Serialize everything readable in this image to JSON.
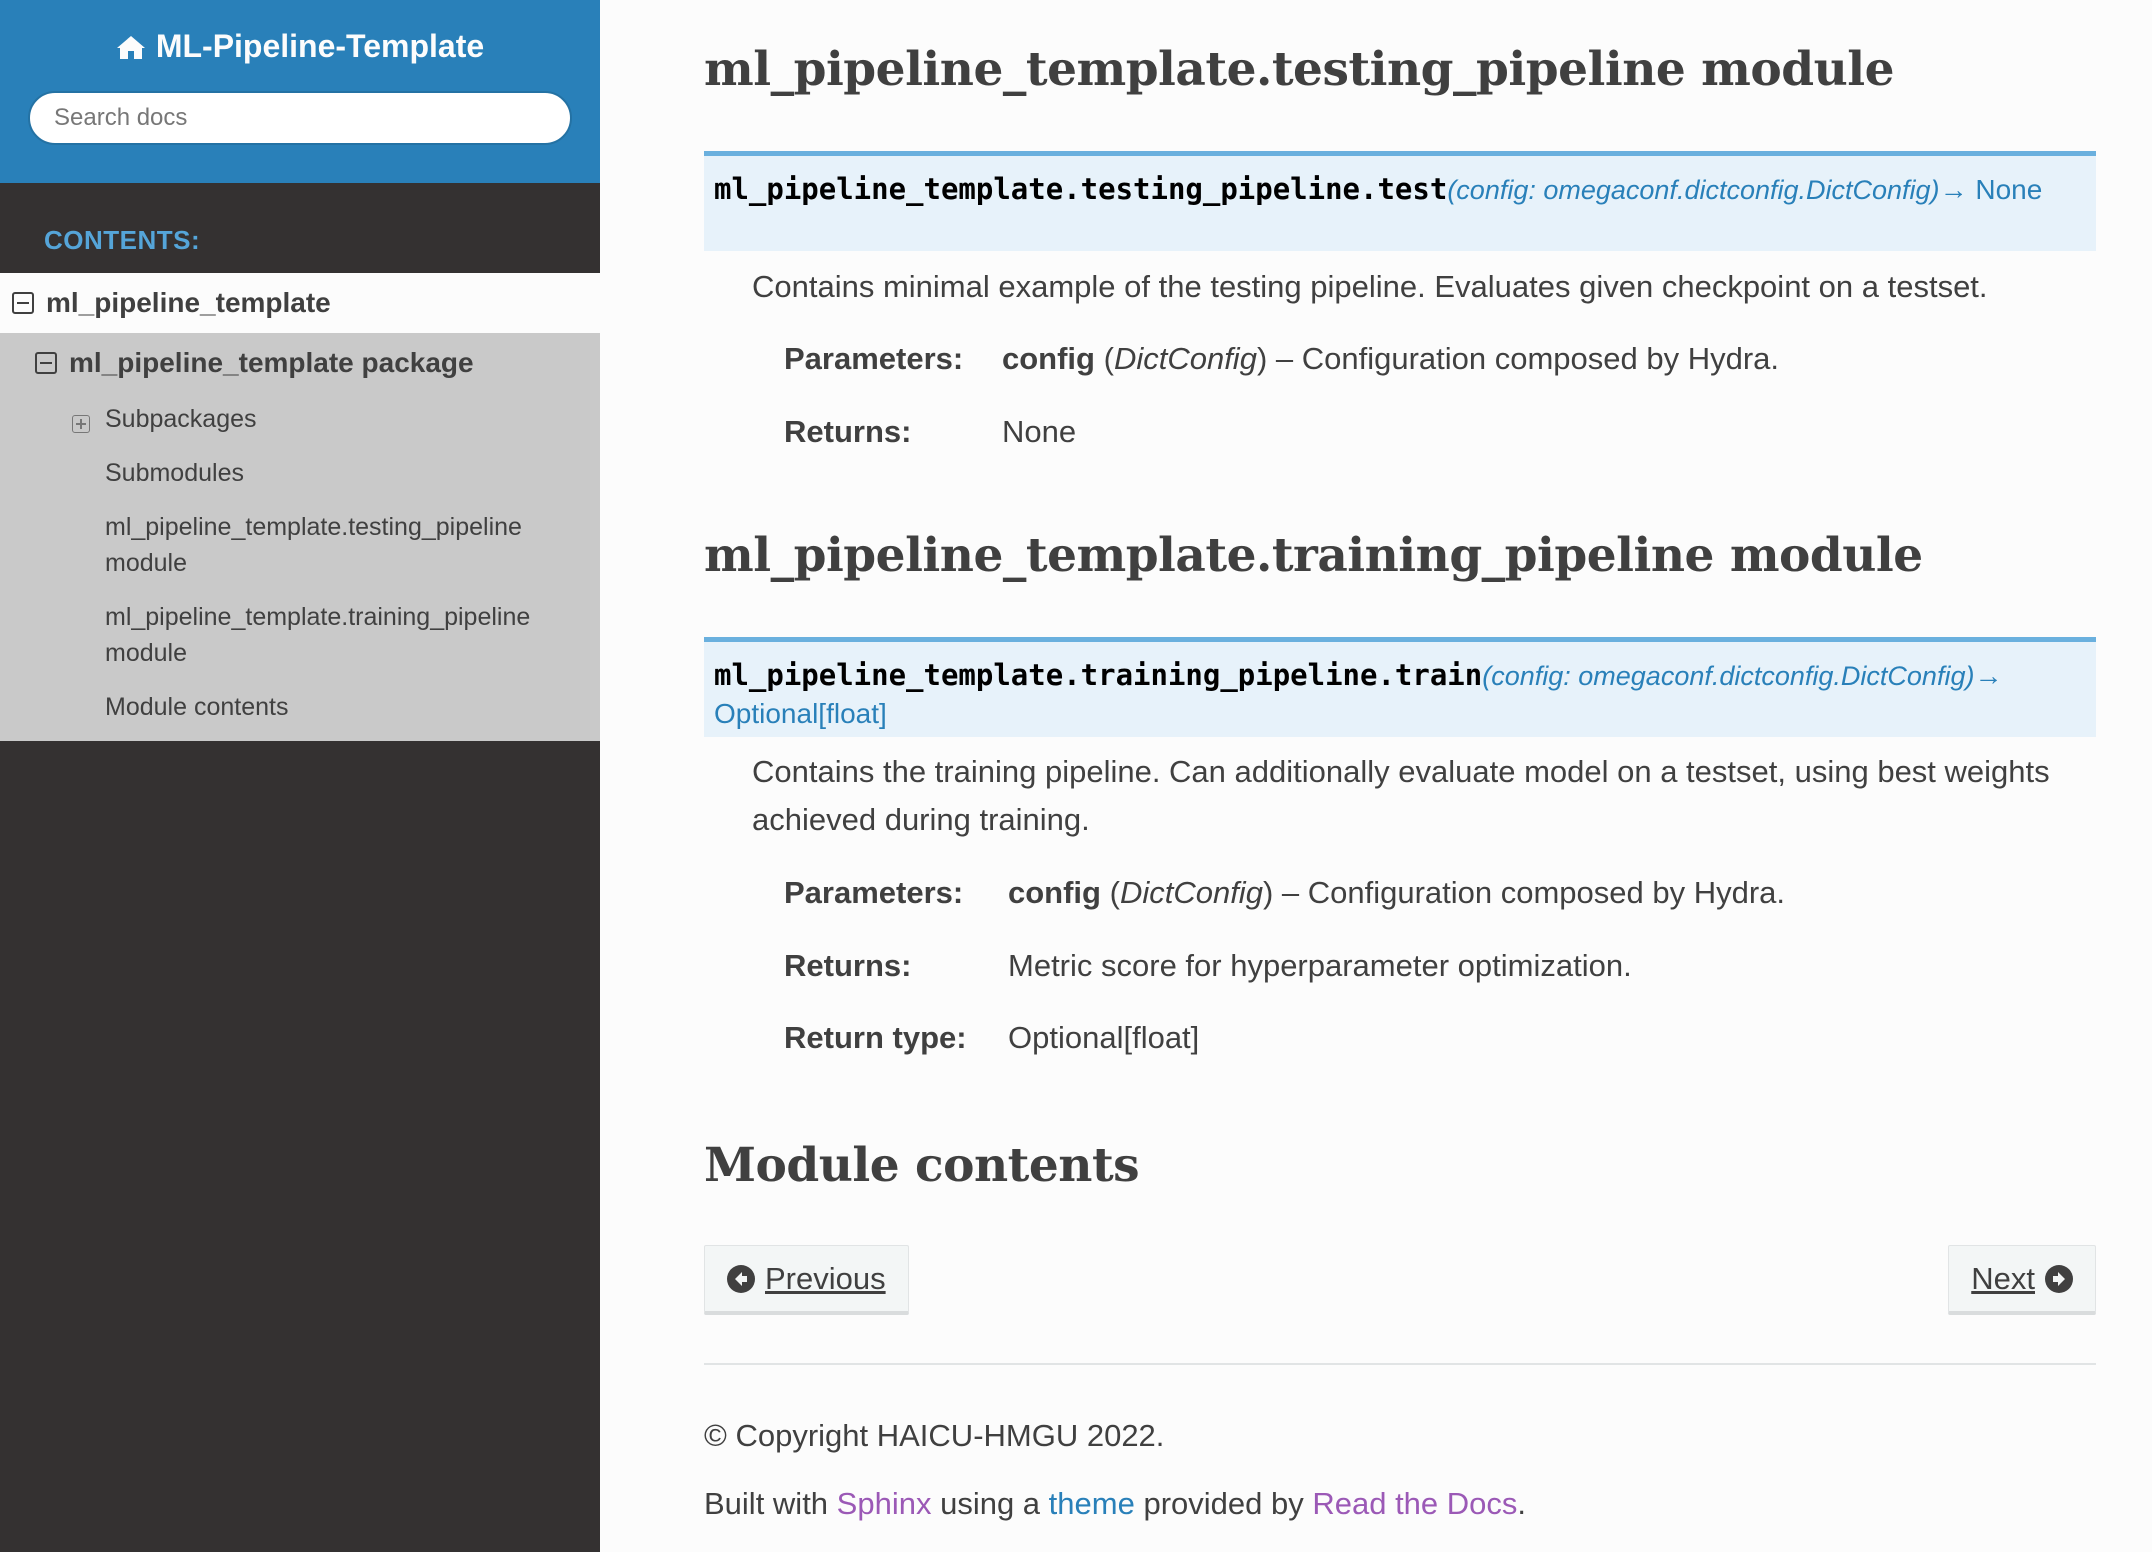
{
  "sidebar": {
    "project_title": "ML-Pipeline-Template",
    "search_placeholder": "Search docs",
    "caption": "CONTENTS:",
    "toc": {
      "level1": "ml_pipeline_template",
      "level2": "ml_pipeline_template package",
      "items": [
        {
          "label": "Subpackages"
        },
        {
          "label": "Submodules"
        },
        {
          "label": "ml_pipeline_template.testing_pipeline module"
        },
        {
          "label": "ml_pipeline_template.training_pipeline module"
        },
        {
          "label": "Module contents"
        }
      ]
    }
  },
  "content": {
    "testing": {
      "heading": "ml_pipeline_template.testing_pipeline module",
      "sig_name": "ml_pipeline_template.testing_pipeline.test",
      "sig_params": "(config: omegaconf.dictconfig.DictConfig)",
      "sig_arrow": "→",
      "sig_return": "None",
      "description": "Contains minimal example of the testing pipeline. Evaluates given checkpoint on a testset.",
      "param_label": "Parameters:",
      "param_name": "config",
      "param_type": "DictConfig",
      "param_desc": " – Configuration composed by Hydra.",
      "returns_label": "Returns:",
      "returns_value": "None"
    },
    "training": {
      "heading": "ml_pipeline_template.training_pipeline module",
      "sig_name": "ml_pipeline_template.training_pipeline.train",
      "sig_params": "(config: omegaconf.dictconfig.DictConfig)",
      "sig_arrow": "→",
      "sig_return": "Optional[float]",
      "description": "Contains the training pipeline. Can additionally evaluate model on a testset, using best weights achieved during training.",
      "param_label": "Parameters:",
      "param_name": "config",
      "param_type": "DictConfig",
      "param_desc": " – Configuration composed by Hydra.",
      "returns_label": "Returns:",
      "returns_value": "Metric score for hyperparameter optimization.",
      "return_type_label": "Return type:",
      "return_type_value": "Optional[float]"
    },
    "module_contents_heading": "Module contents",
    "nav": {
      "previous": "Previous",
      "next": "Next"
    },
    "footer": {
      "copyright": "© Copyright HAICU-HMGU 2022.",
      "built_with": "Built with ",
      "sphinx": "Sphinx",
      "using_a": " using a ",
      "theme": "theme",
      "provided_by": " provided by ",
      "rtd": "Read the Docs",
      "period": "."
    }
  },
  "colors": {
    "sidebar_header": "#2980b9",
    "sidebar_bg": "#343131",
    "toc_bg": "#c9c9c9",
    "signature_bg": "#e7f2fa",
    "signature_border": "#6ab0de",
    "link_blue": "#2980b9",
    "link_purple": "#9b59b6"
  },
  "icons": [
    "home-icon",
    "collapse-icon",
    "expand-icon",
    "arrow-circle-left-icon",
    "arrow-circle-right-icon"
  ]
}
